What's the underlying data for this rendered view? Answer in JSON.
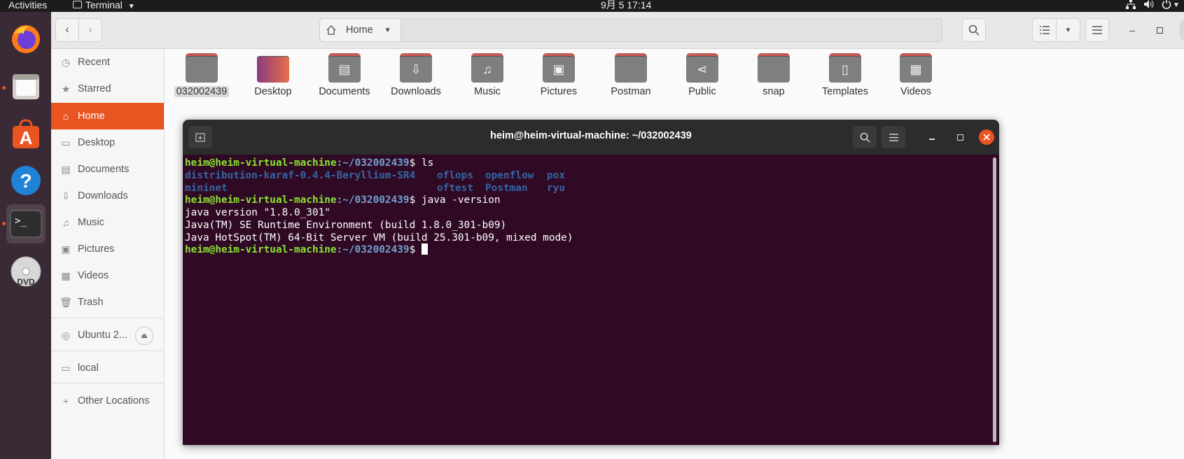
{
  "topbar": {
    "activities": "Activities",
    "app_name": "Terminal",
    "clock": "9月 5  17:14"
  },
  "nautilus": {
    "location": "Home",
    "sidebar": {
      "items": [
        {
          "label": "Recent",
          "icon": "clock-icon"
        },
        {
          "label": "Starred",
          "icon": "star-icon"
        },
        {
          "label": "Home",
          "icon": "home-icon",
          "active": true
        },
        {
          "label": "Desktop",
          "icon": "desktop-icon"
        },
        {
          "label": "Documents",
          "icon": "document-icon"
        },
        {
          "label": "Downloads",
          "icon": "download-icon"
        },
        {
          "label": "Music",
          "icon": "music-icon"
        },
        {
          "label": "Pictures",
          "icon": "picture-icon"
        },
        {
          "label": "Videos",
          "icon": "video-icon"
        },
        {
          "label": "Trash",
          "icon": "trash-icon"
        }
      ],
      "drive": "Ubuntu 2...",
      "local": "local",
      "other_locations": "Other Locations"
    },
    "files": [
      {
        "name": "032002439",
        "selected": true
      },
      {
        "name": "Desktop"
      },
      {
        "name": "Documents"
      },
      {
        "name": "Downloads"
      },
      {
        "name": "Music"
      },
      {
        "name": "Pictures"
      },
      {
        "name": "Postman"
      },
      {
        "name": "Public"
      },
      {
        "name": "snap"
      },
      {
        "name": "Templates"
      },
      {
        "name": "Videos"
      }
    ]
  },
  "terminal": {
    "title": "heim@heim-virtual-machine: ~/032002439",
    "prompt_user": "heim@heim-virtual-machine",
    "prompt_path": ":~/032002439",
    "prompt_symbol": "$ ",
    "cmd1": "ls",
    "ls_col1": [
      "distribution-karaf-0.4.4-Beryllium-SR4",
      "mininet"
    ],
    "ls_col2": [
      "oflops",
      "oftest"
    ],
    "ls_col3": [
      "openflow",
      "Postman"
    ],
    "ls_col4": [
      "pox",
      "ryu"
    ],
    "cmd2": "java -version",
    "out1": "java version \"1.8.0_301\"",
    "out2": "Java(TM) SE Runtime Environment (build 1.8.0_301-b09)",
    "out3": "Java HotSpot(TM) 64-Bit Server VM (build 25.301-b09, mixed mode)"
  },
  "colors": {
    "accent": "#e95420",
    "terminal_bg": "#300a24",
    "prompt_user": "#8ae234",
    "prompt_path": "#729fcf",
    "dir": "#3465a4"
  }
}
